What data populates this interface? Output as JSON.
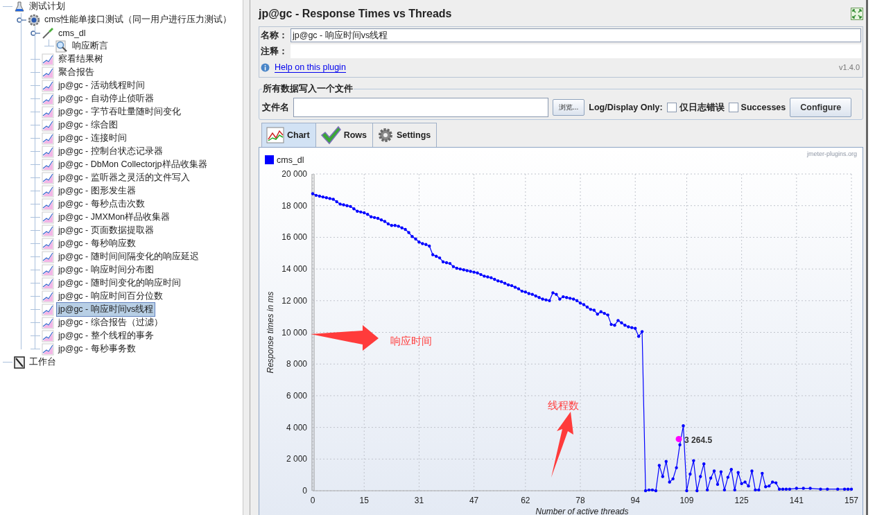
{
  "tree": [
    {
      "label": "测试计划",
      "kind": "plan",
      "selected": false,
      "children": [
        {
          "label": "cms性能单接口测试（同一用户进行压力测试）",
          "kind": "thread-group",
          "selected": false,
          "expanded": true,
          "children": [
            {
              "label": "cms_dl",
              "kind": "sampler",
              "selected": false,
              "expanded": true,
              "children": [
                {
                  "label": "响应断言",
                  "kind": "assertion",
                  "selected": false
                }
              ]
            },
            {
              "label": "察看结果树",
              "kind": "listener",
              "selected": false
            },
            {
              "label": "聚合报告",
              "kind": "listener",
              "selected": false
            },
            {
              "label": "jp@gc - 活动线程时间",
              "kind": "listener",
              "selected": false
            },
            {
              "label": "jp@gc - 自动停止侦听器",
              "kind": "listener",
              "selected": false
            },
            {
              "label": "jp@gc - 字节吞吐量随时间变化",
              "kind": "listener",
              "selected": false
            },
            {
              "label": "jp@gc - 综合图",
              "kind": "listener",
              "selected": false
            },
            {
              "label": "jp@gc - 连接时间",
              "kind": "listener",
              "selected": false
            },
            {
              "label": "jp@gc - 控制台状态记录器",
              "kind": "listener",
              "selected": false
            },
            {
              "label": "jp@gc - DbMon Collectorjp样品收集器",
              "kind": "listener",
              "selected": false
            },
            {
              "label": "jp@gc - 监听器之灵活的文件写入",
              "kind": "listener",
              "selected": false
            },
            {
              "label": "jp@gc - 图形发生器",
              "kind": "listener",
              "selected": false
            },
            {
              "label": "jp@gc - 每秒点击次数",
              "kind": "listener",
              "selected": false
            },
            {
              "label": "jp@gc - JMXMon样品收集器",
              "kind": "listener",
              "selected": false
            },
            {
              "label": "jp@gc - 页面数据提取器",
              "kind": "listener",
              "selected": false
            },
            {
              "label": "jp@gc - 每秒响应数",
              "kind": "listener",
              "selected": false
            },
            {
              "label": "jp@gc - 随时间间隔变化的响应延迟",
              "kind": "listener",
              "selected": false
            },
            {
              "label": "jp@gc - 响应时间分布图",
              "kind": "listener",
              "selected": false
            },
            {
              "label": "jp@gc - 随时间变化的响应时间",
              "kind": "listener",
              "selected": false
            },
            {
              "label": "jp@gc - 响应时间百分位数",
              "kind": "listener",
              "selected": false
            },
            {
              "label": "jp@gc - 响应时间vs线程",
              "kind": "listener",
              "selected": true
            },
            {
              "label": "jp@gc - 综合报告（过滤）",
              "kind": "listener",
              "selected": false
            },
            {
              "label": "jp@gc - 整个线程的事务",
              "kind": "listener",
              "selected": false
            },
            {
              "label": "jp@gc - 每秒事务数",
              "kind": "listener",
              "selected": false
            }
          ]
        }
      ]
    },
    {
      "label": "工作台",
      "kind": "workbench",
      "selected": false
    }
  ],
  "panel": {
    "title": "jp@gc - Response Times vs Threads",
    "name_label": "名称：",
    "name_value": "jp@gc - 响应时间vs线程",
    "comment_label": "注释：",
    "help_link": "Help on this plugin",
    "version": "v1.4.0"
  },
  "file_section": {
    "legend": "所有数据写入一个文件",
    "filename_label": "文件名",
    "browse_button": "浏览...",
    "log_label": "Log/Display Only:",
    "checkboxes": [
      {
        "label": "仅日志错误",
        "checked": false
      },
      {
        "label": "Successes",
        "checked": false
      }
    ],
    "configure_button": "Configure"
  },
  "tabs": [
    {
      "label": "Chart",
      "kind": "chart",
      "selected": true
    },
    {
      "label": "Rows",
      "kind": "rows",
      "selected": false
    },
    {
      "label": "Settings",
      "kind": "settings",
      "selected": false
    }
  ],
  "chart": {
    "credit": "jmeter-plugins.org",
    "callouts": [
      {
        "text": "响应时间"
      },
      {
        "text": "线程数"
      }
    ],
    "chart_data": {
      "type": "line",
      "xlabel": "Number of active threads",
      "ylabel": "Response times in ms",
      "x": [
        0,
        1,
        2,
        3,
        4,
        5,
        6,
        7,
        8,
        9,
        10,
        11,
        12,
        13,
        14,
        15,
        16,
        17,
        18,
        19,
        20,
        21,
        22,
        23,
        24,
        25,
        26,
        27,
        28,
        29,
        30,
        31,
        32,
        33,
        34,
        35,
        36,
        37,
        38,
        39,
        40,
        41,
        42,
        43,
        44,
        45,
        46,
        47,
        48,
        49,
        50,
        51,
        52,
        53,
        54,
        55,
        56,
        57,
        58,
        59,
        60,
        61,
        62,
        63,
        64,
        65,
        66,
        67,
        68,
        69,
        70,
        71,
        72,
        73,
        74,
        75,
        76,
        77,
        78,
        79,
        80,
        81,
        82,
        83,
        84,
        85,
        86,
        87,
        88,
        89,
        90,
        91,
        92,
        93,
        94,
        95,
        96,
        97,
        98,
        99,
        100,
        101,
        102,
        103,
        104,
        105,
        106,
        107,
        108,
        109,
        110,
        111,
        112,
        113,
        114,
        115,
        116,
        117,
        118,
        119,
        120,
        121,
        122,
        123,
        124,
        125,
        126,
        127,
        128,
        129,
        130,
        131,
        132,
        133,
        134,
        135,
        136,
        137,
        138,
        139,
        141,
        143,
        145,
        148,
        150,
        153,
        155,
        156,
        157
      ],
      "series": [
        {
          "name": "cms_dl",
          "color": "#0000ff",
          "values": [
            18750,
            18650,
            18600,
            18550,
            18500,
            18450,
            18400,
            18250,
            18100,
            18050,
            18000,
            17950,
            17800,
            17650,
            17600,
            17550,
            17450,
            17300,
            17250,
            17200,
            17100,
            17000,
            16850,
            16750,
            16750,
            16700,
            16600,
            16500,
            16300,
            16050,
            15900,
            15700,
            15600,
            15550,
            15450,
            14900,
            14800,
            14700,
            14450,
            14400,
            14350,
            14150,
            14050,
            14000,
            13950,
            13900,
            13850,
            13800,
            13750,
            13650,
            13550,
            13500,
            13450,
            13350,
            13250,
            13200,
            13100,
            13000,
            12950,
            12850,
            12750,
            12600,
            12550,
            12450,
            12400,
            12300,
            12200,
            12100,
            12050,
            12000,
            12500,
            12400,
            12100,
            12250,
            12200,
            12150,
            12100,
            12000,
            11850,
            11750,
            11600,
            11450,
            11400,
            11150,
            11300,
            11200,
            11100,
            10500,
            10450,
            10750,
            10600,
            10450,
            10350,
            10300,
            10250,
            9750,
            10050,
            0,
            50,
            50,
            0,
            1600,
            900,
            1850,
            550,
            750,
            1450,
            2900,
            4100,
            0,
            1050,
            1900,
            0,
            900,
            1700,
            50,
            800,
            1250,
            400,
            1200,
            50,
            850,
            1350,
            50,
            1150,
            450,
            550,
            300,
            1250,
            50,
            50,
            1100,
            250,
            300,
            550,
            500,
            100,
            100,
            100,
            100,
            150,
            150,
            150,
            100,
            100,
            100,
            100,
            100,
            100
          ]
        }
      ],
      "xlim": [
        0,
        157
      ],
      "ylim": [
        0,
        20000
      ],
      "xticks": [
        0,
        15,
        31,
        47,
        62,
        78,
        94,
        109,
        125,
        141,
        157
      ],
      "grid": true,
      "yticks": [
        0,
        {
          "value": 2000,
          "label": "2 000"
        },
        {
          "value": 4000,
          "label": "4 000"
        },
        {
          "value": 6000,
          "label": "6 000"
        },
        {
          "value": 8000,
          "label": "8 000"
        },
        {
          "value": 10000,
          "label": "10 000"
        },
        {
          "value": 12000,
          "label": "12 000"
        },
        {
          "value": 14000,
          "label": "14 000"
        },
        {
          "value": 16000,
          "label": "16 000"
        },
        {
          "value": 18000,
          "label": "18 000"
        },
        {
          "value": 20000,
          "label": "20 000"
        }
      ],
      "annotations": [
        {
          "text": "3 264.5"
        }
      ]
    }
  }
}
